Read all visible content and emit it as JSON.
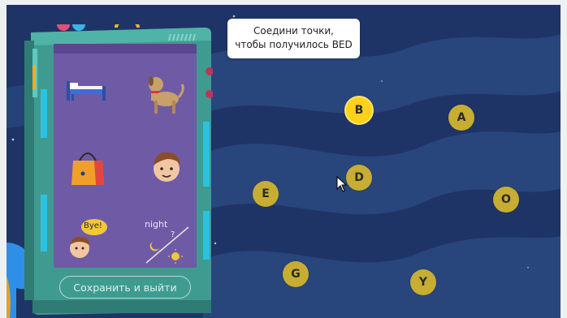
{
  "instruction": {
    "line1": "Соедини точки,",
    "line2": "чтобы получилось BED"
  },
  "save_button": {
    "label": "Сохранить и выйти"
  },
  "cards": [
    {
      "icon": "bed-icon"
    },
    {
      "icon": "dog-icon"
    },
    {
      "icon": "bag-icon"
    },
    {
      "icon": "boy-face-icon"
    },
    {
      "icon": "boy-bye-icon",
      "speech": "Bye!"
    },
    {
      "icon": "night-icon",
      "text": "night",
      "mark": "?"
    }
  ],
  "dots": [
    {
      "letter": "B",
      "active": true
    },
    {
      "letter": "A",
      "active": false
    },
    {
      "letter": "D",
      "active": false
    },
    {
      "letter": "E",
      "active": false
    },
    {
      "letter": "O",
      "active": false
    },
    {
      "letter": "G",
      "active": false
    },
    {
      "letter": "Y",
      "active": false
    }
  ],
  "colors": {
    "background": "#1f3466",
    "wave": "#2a4a82",
    "device": "#3f9b90",
    "screen": "#6f5aa6",
    "dot": "#c7ad32",
    "dot_active": "#ffd21a"
  }
}
